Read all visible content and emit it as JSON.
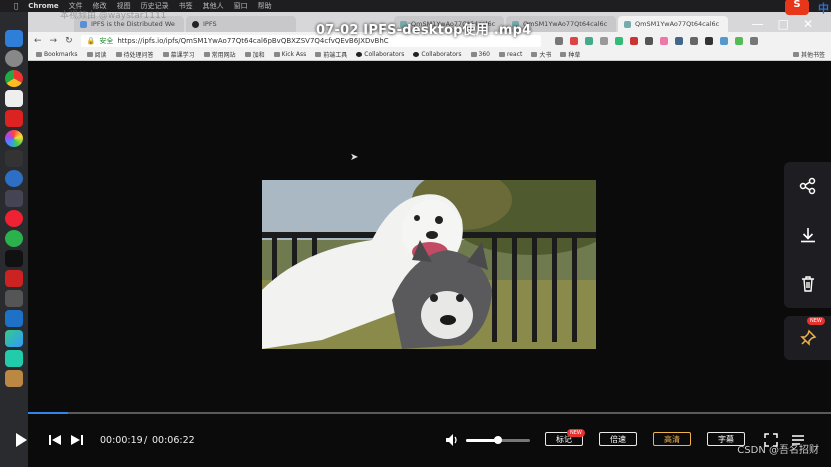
{
  "menubar": {
    "app": "Chrome",
    "items": [
      "文件",
      "修改",
      "视图",
      "历史记录",
      "书签",
      "其他人",
      "窗口",
      "帮助"
    ]
  },
  "watermark": "本视频由 @waystar1111",
  "tabs": [
    {
      "label": "IPFS is the Distributed We"
    },
    {
      "label": "IPFS"
    },
    {
      "label": "QmSM1YwAo77Qt64cal6c"
    },
    {
      "label": "QmSM1YwAo77Qt64cal6c"
    },
    {
      "label": "QmSM1YwAo77Qt64cal6c"
    }
  ],
  "address": {
    "secure_label": "安全",
    "url": "https://ipfs.io/ipfs/QmSM1YwAo77Qt64cal6pBvQBXZSV7Q4cfvQEvB6JXDvBhC"
  },
  "bookmarks": [
    "Bookmarks",
    "阅读",
    "待处理问答",
    "慕课学习",
    "常用网站",
    "加和",
    "Kick Ass",
    "前端工具",
    "Collaborators",
    "Collaborators",
    "360",
    "react",
    "大书",
    "种草"
  ],
  "bookmarks_other": "其他书签",
  "video": {
    "title": "07-02 IPFS-desktop使用 .mp4",
    "current_time": "00:00:19",
    "separator": "/",
    "duration": "00:06:22",
    "progress": 0.05,
    "volume": 0.5
  },
  "controls": {
    "notes_label": "标记",
    "notes_badge": "NEW",
    "speed_label": "倍速",
    "quality_label": "高清",
    "subtitle_label": "字幕"
  },
  "side": {
    "pin_badge": "NEW"
  },
  "csdn": {
    "logo": "S",
    "zh": "中",
    "credit": "CSDN @吾名招财"
  }
}
